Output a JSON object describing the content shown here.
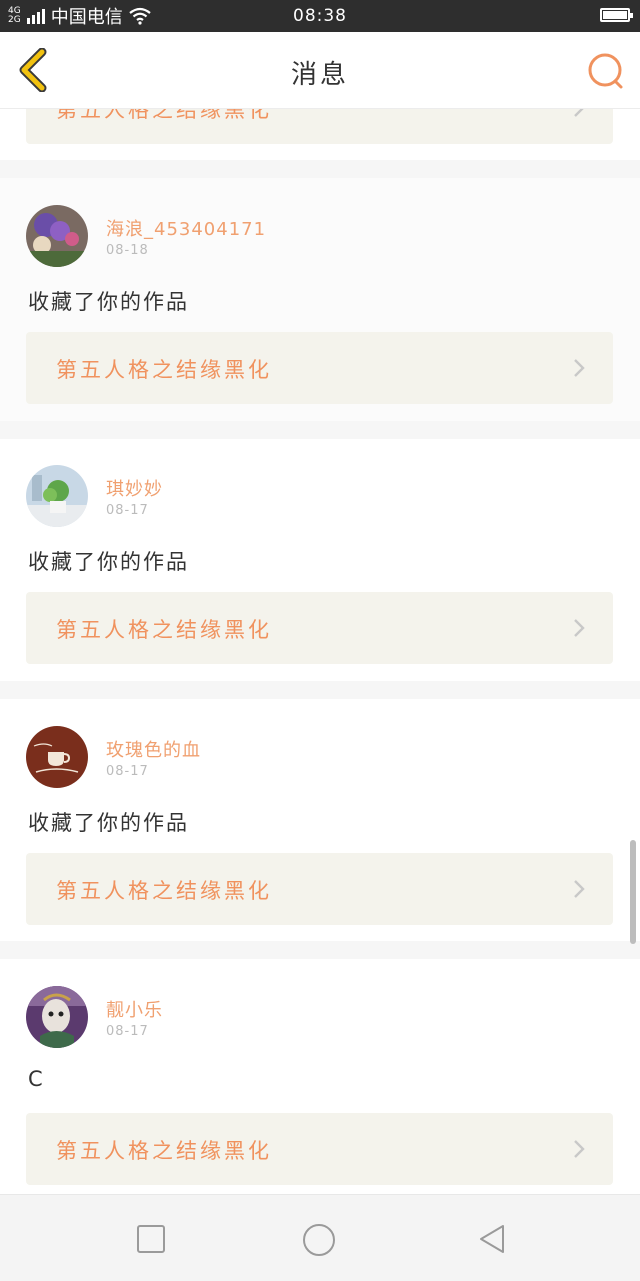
{
  "status_bar": {
    "network_top": "4G",
    "network_bottom": "2G",
    "carrier": "中国电信",
    "time": "08:38",
    "icons": [
      "signal-icon",
      "wifi-icon",
      "battery-icon"
    ]
  },
  "header": {
    "title": "消息",
    "back_icon": "chevron-left-icon",
    "search_icon": "search-icon"
  },
  "colors": {
    "accent": "#f0925e",
    "username": "#f0a070",
    "back_icon": "#f2c20f",
    "card_link_bg": "#f4f3ec"
  },
  "messages": [
    {
      "work_title": "第五人格之结缘黑化"
    },
    {
      "username": "海浪_453404171",
      "date": "08-18",
      "text": "收藏了你的作品",
      "work_title": "第五人格之结缘黑化"
    },
    {
      "username": "琪妙妙",
      "date": "08-17",
      "text": "收藏了你的作品",
      "work_title": "第五人格之结缘黑化"
    },
    {
      "username": "玫瑰色的血",
      "date": "08-17",
      "text": "收藏了你的作品",
      "work_title": "第五人格之结缘黑化"
    },
    {
      "username": "靓小乐",
      "date": "08-17",
      "text": "C",
      "work_title": "第五人格之结缘黑化"
    }
  ],
  "nav_bar": {
    "icons": [
      "recents-square-icon",
      "home-circle-icon",
      "back-triangle-icon"
    ]
  }
}
